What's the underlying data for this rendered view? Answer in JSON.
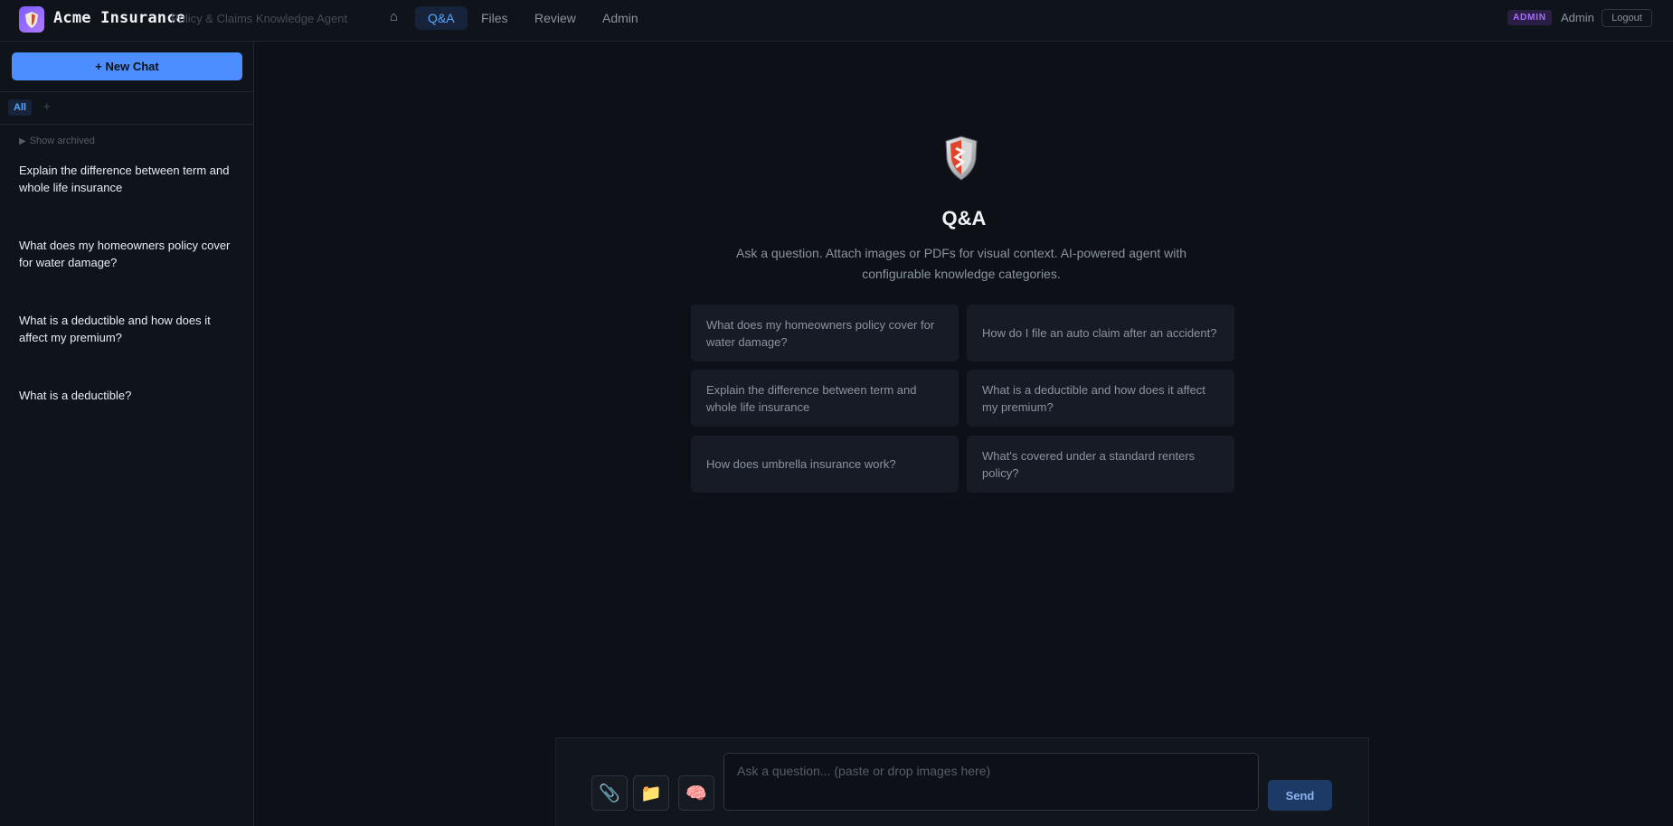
{
  "app": {
    "brand": "Acme Insurance",
    "tagline": "Policy & Claims Knowledge Agent"
  },
  "nav": {
    "home_glyph": "⌂",
    "items": [
      {
        "label": "Q&A",
        "active": true
      },
      {
        "label": "Files",
        "active": false
      },
      {
        "label": "Review",
        "active": false
      },
      {
        "label": "Admin",
        "active": false
      }
    ]
  },
  "user": {
    "role_badge": "ADMIN",
    "name": "Admin",
    "logout_label": "Logout"
  },
  "sidebar": {
    "new_chat_label": "+ New Chat",
    "category_tab": "All",
    "add_category": "+",
    "show_archived": "Show archived",
    "conversations": [
      "Explain the difference between term and whole life insurance",
      "What does my homeowners policy cover for water damage?",
      "What is a deductible and how does it affect my premium?",
      "What is a deductible?"
    ]
  },
  "main": {
    "title": "Q&A",
    "subtitle": "Ask a question. Attach images or PDFs for visual context. AI-powered agent with configurable knowledge categories.",
    "suggestions": [
      "What does my homeowners policy cover for water damage?",
      "How do I file an auto claim after an accident?",
      "Explain the difference between term and whole life insurance",
      "What is a deductible and how does it affect my premium?",
      "How does umbrella insurance work?",
      "What's covered under a standard renters policy?"
    ]
  },
  "composer": {
    "placeholder": "Ask a question... (paste or drop images here)",
    "value": "",
    "send_label": "Send",
    "tools": {
      "attach": "📎",
      "folder": "📁",
      "brain": "🧠"
    }
  },
  "colors": {
    "accent": "#4c8dff",
    "active_nav": "#58a6ff",
    "admin_badge": "#a371f7",
    "background": "#0d1117"
  }
}
